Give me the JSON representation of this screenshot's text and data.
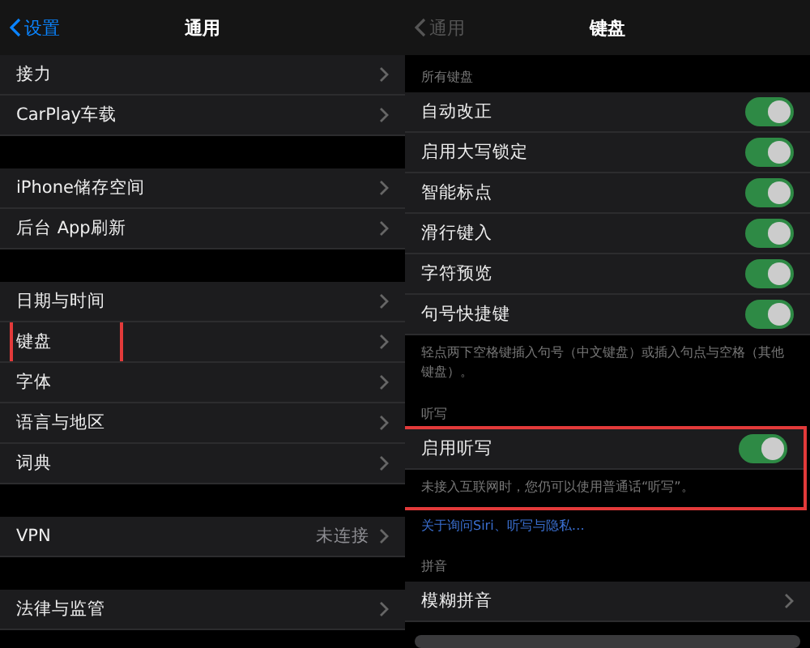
{
  "general_screen": {
    "back": "设置",
    "title": "通用",
    "groups": [
      {
        "rows": [
          {
            "label": "接力",
            "value": ""
          },
          {
            "label": "CarPlay车载",
            "value": ""
          }
        ]
      },
      {
        "rows": [
          {
            "label": "iPhone储存空间",
            "value": ""
          },
          {
            "label": "后台 App刷新",
            "value": ""
          }
        ]
      },
      {
        "rows": [
          {
            "label": "日期与时间",
            "value": ""
          },
          {
            "label": "键盘",
            "value": "",
            "highlighted": true
          },
          {
            "label": "字体",
            "value": ""
          },
          {
            "label": "语言与地区",
            "value": ""
          },
          {
            "label": "词典",
            "value": ""
          }
        ]
      },
      {
        "rows": [
          {
            "label": "VPN",
            "value": "未连接"
          }
        ]
      },
      {
        "rows": [
          {
            "label": "法律与监管",
            "value": ""
          }
        ]
      }
    ]
  },
  "keyboard_screen": {
    "back": "通用",
    "title": "键盘",
    "sections": [
      {
        "header": "所有键盘",
        "rows": [
          {
            "kind": "toggle",
            "label": "自动改正",
            "on": true
          },
          {
            "kind": "toggle",
            "label": "启用大写锁定",
            "on": true
          },
          {
            "kind": "toggle",
            "label": "智能标点",
            "on": true
          },
          {
            "kind": "toggle",
            "label": "滑行键入",
            "on": true
          },
          {
            "kind": "toggle",
            "label": "字符预览",
            "on": true
          },
          {
            "kind": "toggle",
            "label": "句号快捷键",
            "on": true
          }
        ],
        "footer": "轻点两下空格键插入句号（中文键盘）或插入句点与空格（其他键盘）。"
      },
      {
        "header": "听写",
        "highlighted": true,
        "rows": [
          {
            "kind": "toggle",
            "label": "启用听写",
            "on": true
          }
        ],
        "footer": "未接入互联网时，您仍可以使用普通话“听写”。"
      },
      {
        "link": "关于询问Siri、听写与隐私…"
      },
      {
        "header": "拼音",
        "rows": [
          {
            "kind": "link",
            "label": "模糊拼音"
          }
        ]
      }
    ]
  }
}
